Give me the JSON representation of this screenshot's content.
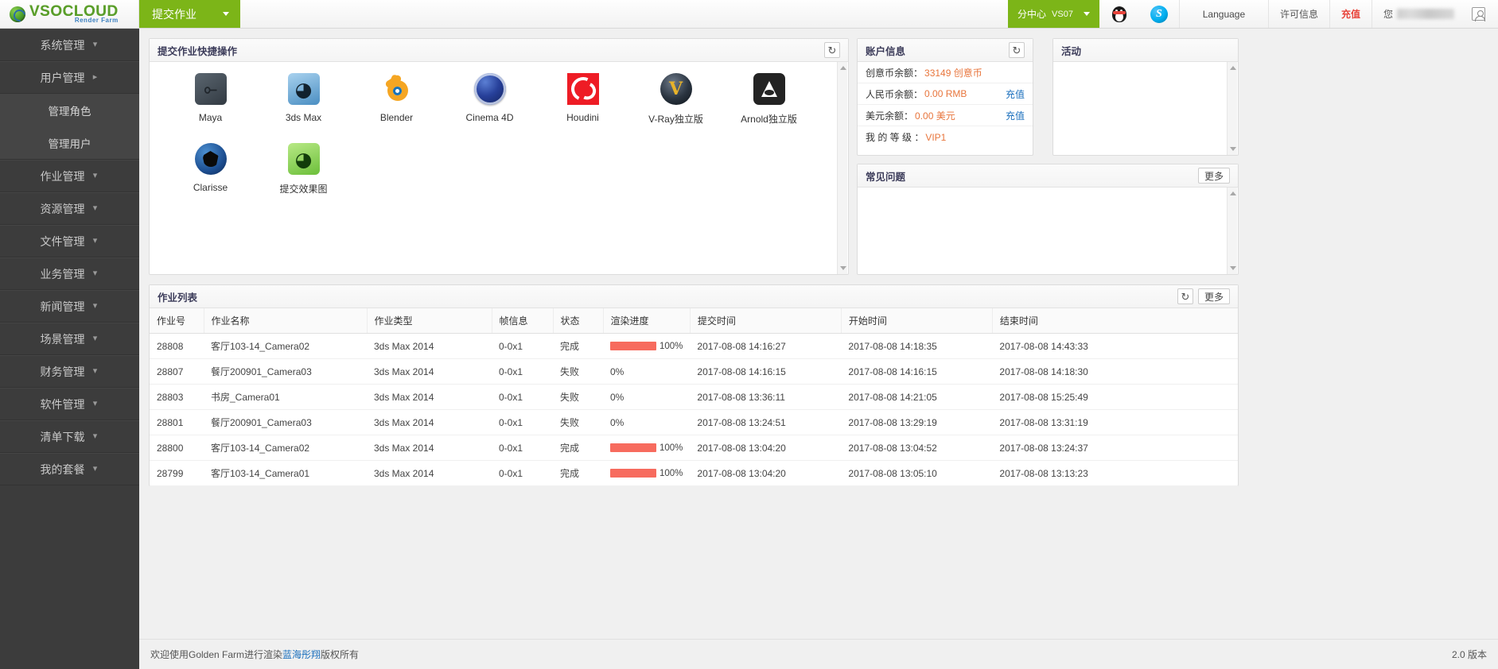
{
  "topbar": {
    "logo_main": "VSOCLOUD",
    "logo_sub": "Render Farm",
    "submit_job": "提交作业",
    "branch_label": "分中心",
    "branch_code": "VS07",
    "qq_icon": "qq-penguin-icon",
    "skype_icon": "skype-icon",
    "language": "Language",
    "license_info": "许可信息",
    "recharge": "充值",
    "user_greeting": "您",
    "avatar_icon": "user-avatar-icon"
  },
  "sidebar": {
    "items": [
      {
        "label": "系统管理",
        "chevron": "down",
        "children": []
      },
      {
        "label": "用户管理",
        "chevron": "right",
        "children": [
          {
            "label": "管理角色"
          },
          {
            "label": "管理用户"
          }
        ]
      },
      {
        "label": "作业管理",
        "chevron": "down",
        "children": []
      },
      {
        "label": "资源管理",
        "chevron": "down",
        "children": []
      },
      {
        "label": "文件管理",
        "chevron": "down",
        "children": []
      },
      {
        "label": "业务管理",
        "chevron": "down",
        "children": []
      },
      {
        "label": "新闻管理",
        "chevron": "down",
        "children": []
      },
      {
        "label": "场景管理",
        "chevron": "down",
        "children": []
      },
      {
        "label": "财务管理",
        "chevron": "down",
        "children": []
      },
      {
        "label": "软件管理",
        "chevron": "down",
        "children": []
      },
      {
        "label": "清单下载",
        "chevron": "down",
        "children": []
      },
      {
        "label": "我的套餐",
        "chevron": "down",
        "children": []
      }
    ]
  },
  "quick_panel": {
    "title": "提交作业快捷操作",
    "refresh_icon": "refresh-icon",
    "apps": [
      {
        "label": "Maya",
        "icon": "maya-icon"
      },
      {
        "label": "3ds Max",
        "icon": "3dsmax-icon"
      },
      {
        "label": "Blender",
        "icon": "blender-icon"
      },
      {
        "label": "Cinema 4D",
        "icon": "cinema4d-icon"
      },
      {
        "label": "Houdini",
        "icon": "houdini-icon"
      },
      {
        "label": "V-Ray独立版",
        "icon": "vray-icon"
      },
      {
        "label": "Arnold独立版",
        "icon": "arnold-icon"
      },
      {
        "label": "Clarisse",
        "icon": "clarisse-icon"
      },
      {
        "label": "提交效果图",
        "icon": "effect-render-icon"
      }
    ]
  },
  "account_panel": {
    "title": "账户信息",
    "refresh_icon": "refresh-icon",
    "rows": [
      {
        "label": "创意币余额：",
        "value": "33149 创意币",
        "action": ""
      },
      {
        "label": "人民币余额：",
        "value": "0.00 RMB",
        "action": "充值"
      },
      {
        "label": "美元余额：",
        "value": "0.00 美元",
        "action": "充值"
      },
      {
        "label": "我 的 等 级 ：",
        "value": "VIP1",
        "action": ""
      }
    ]
  },
  "activity_panel": {
    "title": "活动"
  },
  "faq_panel": {
    "title": "常见问题",
    "more": "更多"
  },
  "joblist": {
    "title": "作业列表",
    "refresh_icon": "refresh-icon",
    "more": "更多",
    "columns": [
      "作业号",
      "作业名称",
      "作业类型",
      "帧信息",
      "状态",
      "渲染进度",
      "提交时间",
      "开始时间",
      "结束时间"
    ],
    "rows": [
      {
        "id": "28808",
        "name": "客厅103-14_Camera02",
        "type": "3ds Max 2014",
        "frames": "0-0x1",
        "status": "完成",
        "progress": 100,
        "progress_text": "100%",
        "submit_time": "2017-08-08 14:16:27",
        "start_time": "2017-08-08 14:18:35",
        "end_time": "2017-08-08 14:43:33"
      },
      {
        "id": "28807",
        "name": "餐厅200901_Camera03",
        "type": "3ds Max 2014",
        "frames": "0-0x1",
        "status": "失败",
        "progress": 0,
        "progress_text": "0%",
        "submit_time": "2017-08-08 14:16:15",
        "start_time": "2017-08-08 14:16:15",
        "end_time": "2017-08-08 14:18:30"
      },
      {
        "id": "28803",
        "name": "书房_Camera01",
        "type": "3ds Max 2014",
        "frames": "0-0x1",
        "status": "失败",
        "progress": 0,
        "progress_text": "0%",
        "submit_time": "2017-08-08 13:36:11",
        "start_time": "2017-08-08 14:21:05",
        "end_time": "2017-08-08 15:25:49"
      },
      {
        "id": "28801",
        "name": "餐厅200901_Camera03",
        "type": "3ds Max 2014",
        "frames": "0-0x1",
        "status": "失败",
        "progress": 0,
        "progress_text": "0%",
        "submit_time": "2017-08-08 13:24:51",
        "start_time": "2017-08-08 13:29:19",
        "end_time": "2017-08-08 13:31:19"
      },
      {
        "id": "28800",
        "name": "客厅103-14_Camera02",
        "type": "3ds Max 2014",
        "frames": "0-0x1",
        "status": "完成",
        "progress": 100,
        "progress_text": "100%",
        "submit_time": "2017-08-08 13:04:20",
        "start_time": "2017-08-08 13:04:52",
        "end_time": "2017-08-08 13:24:37"
      },
      {
        "id": "28799",
        "name": "客厅103-14_Camera01",
        "type": "3ds Max 2014",
        "frames": "0-0x1",
        "status": "完成",
        "progress": 100,
        "progress_text": "100%",
        "submit_time": "2017-08-08 13:04:20",
        "start_time": "2017-08-08 13:05:10",
        "end_time": "2017-08-08 13:13:23"
      }
    ]
  },
  "footer": {
    "text_before": "欢迎使用Golden Farm进行渲染 ",
    "link": "蓝海彤翔",
    "text_after": " 版权所有",
    "version": "2.0 版本"
  },
  "colors": {
    "brand_green": "#7cb518",
    "accent_orange": "#e8753c",
    "link_blue": "#1a6fbd",
    "recharge_red": "#e8453c",
    "progress_red": "#f76b5e"
  }
}
